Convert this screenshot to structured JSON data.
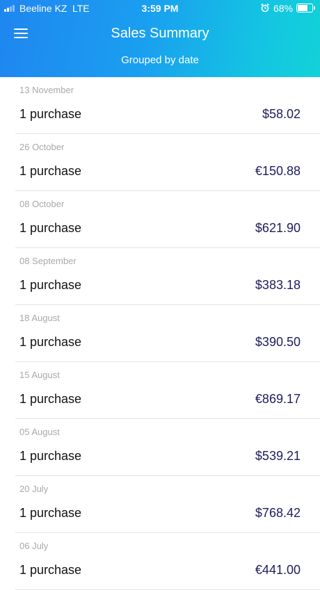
{
  "status_bar": {
    "carrier": "Beeline KZ",
    "network": "LTE",
    "time": "3:59 PM",
    "battery": "68%",
    "battery_level": 0.68,
    "alarm_icon": "alarm-clock-icon"
  },
  "header": {
    "title": "Sales Summary",
    "subtitle": "Grouped by date",
    "menu_icon": "hamburger-menu-icon",
    "gradient_colors": [
      "#1f86f0",
      "#12d2d8"
    ]
  },
  "accent_amount_color": "#1b1d5c",
  "rows": [
    {
      "date": "13 November",
      "count": "1 purchase",
      "amount": "$58.02"
    },
    {
      "date": "26 October",
      "count": "1 purchase",
      "amount": "€150.88"
    },
    {
      "date": "08 October",
      "count": "1 purchase",
      "amount": "$621.90"
    },
    {
      "date": "08 September",
      "count": "1 purchase",
      "amount": "$383.18"
    },
    {
      "date": "18 August",
      "count": "1 purchase",
      "amount": "$390.50"
    },
    {
      "date": "15 August",
      "count": "1 purchase",
      "amount": "€869.17"
    },
    {
      "date": "05 August",
      "count": "1 purchase",
      "amount": "$539.21"
    },
    {
      "date": "20 July",
      "count": "1 purchase",
      "amount": "$768.42"
    },
    {
      "date": "06 July",
      "count": "1 purchase",
      "amount": "€441.00"
    }
  ]
}
